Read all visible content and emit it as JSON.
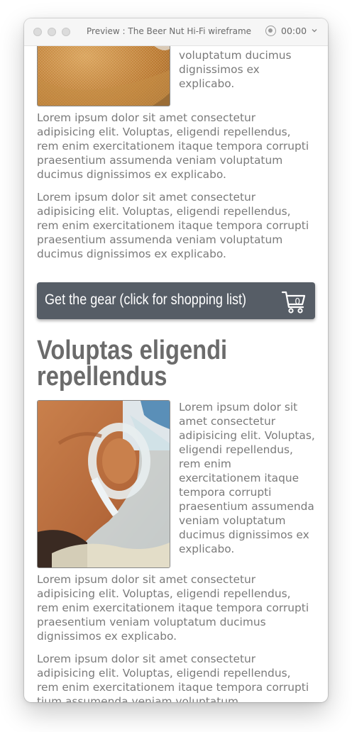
{
  "window": {
    "title": "Preview : The Beer Nut Hi-Fi wireframe",
    "timer": "00:00"
  },
  "icons": {
    "record": "record-icon",
    "chevron": "chevron-down-icon",
    "cart": "shopping-cart-icon"
  },
  "section1": {
    "image_alt": "beer-strainer-photo",
    "side_text": "assumenda veniam voluptatum ducimus dignissimos ex explicabo.",
    "paragraphs": [
      "Lorem ipsum dolor sit amet consectetur adipisicing elit. Voluptas, eligendi repellendus, rem enim exercitationem itaque tempora corrupti praesentium assumenda veniam voluptatum ducimus dignissimos ex explicabo.",
      "Lorem ipsum dolor sit amet consectetur adipisicing elit. Voluptas, eligendi repellendus, rem enim exercitationem itaque tempora corrupti praesentium assumenda veniam voluptatum ducimus dignissimos ex explicabo."
    ]
  },
  "gear_button": {
    "label": "Get the gear (click for shopping list)",
    "cart_count": "0"
  },
  "section2": {
    "heading": "Voluptas eligendi repellendus",
    "image_alt": "fermenting-jug-photo",
    "side_text": "Lorem ipsum dolor sit amet consectetur adipisicing elit. Voluptas, eligendi repellendus, rem enim exercitationem itaque tempora corrupti praesentium assumenda veniam voluptatum ducimus dignissimos ex explicabo.",
    "paragraphs": [
      "Lorem ipsum dolor sit amet consectetur adipisicing elit. Voluptas, eligendi repellendus, rem enim exercitationem itaque tempora corrupti praesentium veniam voluptatum ducimus dignissimos ex explicabo.",
      "Lorem ipsum dolor sit amet consectetur adipisicing elit. Voluptas, eligendi repellendus, rem enim exercitationem itaque tempora corrupti tium assumenda veniam voluptatum"
    ]
  },
  "colors": {
    "button_bg": "#565d66",
    "text": "#7a7a7a",
    "heading": "#6b6b6b"
  }
}
